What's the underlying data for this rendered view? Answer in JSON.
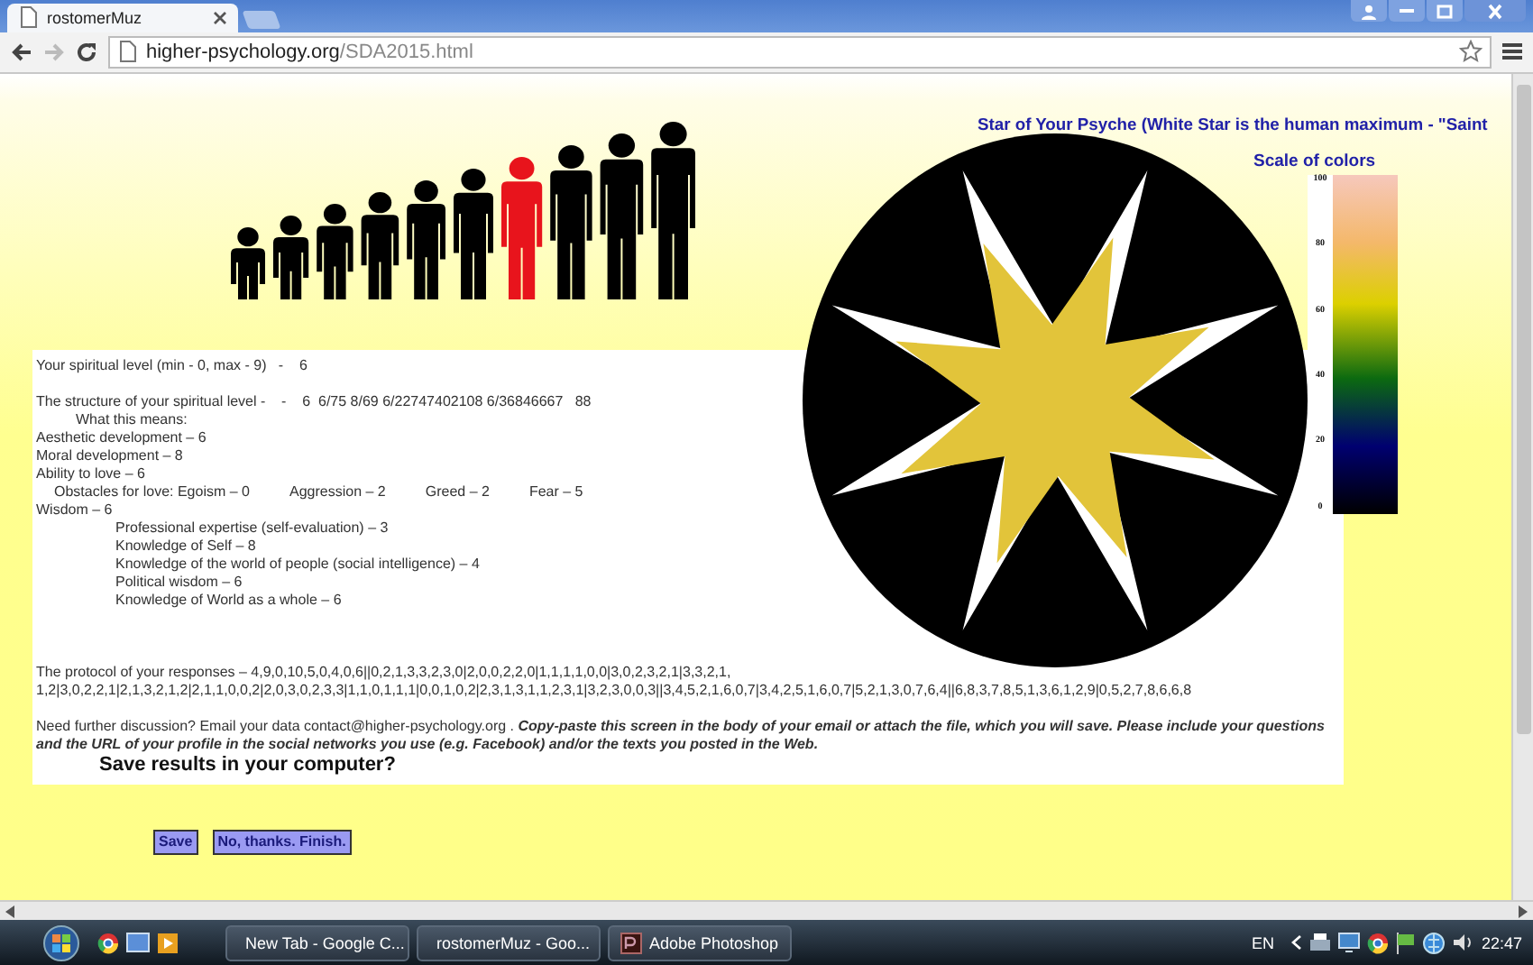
{
  "browser": {
    "tab": {
      "title": "rostomerMuz"
    },
    "address": {
      "host": "higher-psychology.org",
      "path": "/SDA2015.html"
    }
  },
  "page": {
    "chart_title": "Star of Your Psyche (White Star is the human maximum - \"Saint",
    "scale": {
      "title": "Scale of colors",
      "ticks": [
        "100",
        "80",
        "60",
        "40",
        "20",
        "0"
      ]
    },
    "results": {
      "level_line": "Your spiritual level (min - 0, max - 9)   -    6",
      "structure_line": "The structure of your spiritual level -    -    6  6/75 8/69 6/22747402108 6/36846667   88",
      "means_heading": "What this means:",
      "development": [
        "Aesthetic development – 6",
        "Moral development – 8",
        "Ability to love – 6"
      ],
      "obstacles": [
        "Obstacles for love: Egoism – 0",
        "Aggression – 2",
        "Greed – 2",
        "Fear – 5"
      ],
      "wisdom": "Wisdom – 6",
      "wisdom_parts": [
        "Professional expertise (self-evaluation) – 3",
        "Knowledge of Self – 8",
        "Knowledge of the world of people (social intelligence) – 4",
        "Political wisdom – 6",
        "Knowledge of World as a whole – 6"
      ],
      "protocol": "The protocol of your responses – 4,9,0,10,5,0,4,0,6||0,2,1,3,3,2,3,0|2,0,0,2,2,0|1,1,1,1,0,0|3,0,2,3,2,1|3,3,2,1, 1,2|3,0,2,2,1|2,1,3,2,1,2|2,1,1,0,0,2|2,0,3,0,2,3,3|1,1,0,1,1,1|0,0,1,0,2|2,3,1,3,1,1,2,3,1|3,2,3,0,0,3||3,4,5,2,1,6,0,7|3,4,2,5,1,6,0,7|5,2,1,3,0,7,6,4||6,8,3,7,8,5,1,3,6,1,2,9|0,5,2,7,8,6,6,8",
      "discussion": "Need further discussion? Email your data contact@higher-psychology.org . **Copy-paste this screen in the body of your email or attach the file, which you will save. Please include your questions and the URL of your profile in the social networks you use (e.g. Facebook) and/or the texts you posted in the Web.**",
      "save_prompt": "Save results in your computer?"
    },
    "buttons": [
      "Save",
      "No, thanks. Finish."
    ]
  },
  "taskbar": {
    "tasks": [
      {
        "label": "New Tab - Google C...",
        "kind": "browser"
      },
      {
        "label": "rostomerMuz - Goo...",
        "kind": "browser"
      },
      {
        "label": "Adobe Photoshop",
        "kind": "editor"
      }
    ],
    "language": "EN",
    "time": "22:47"
  }
}
